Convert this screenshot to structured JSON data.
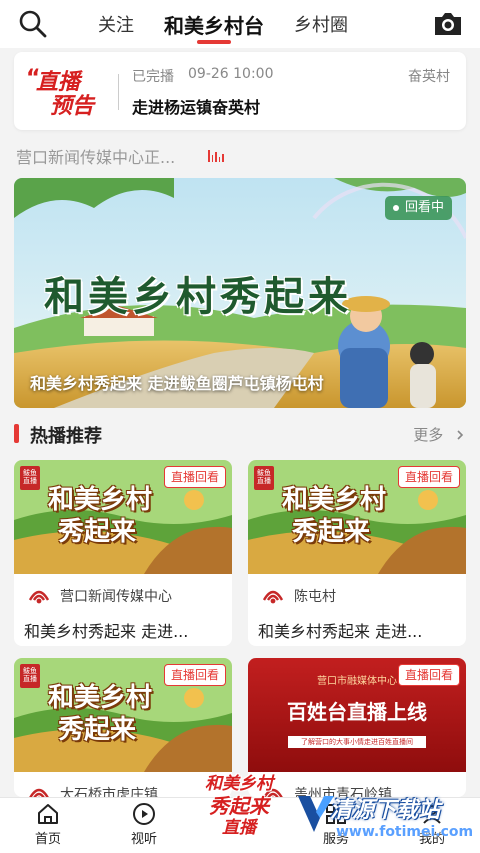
{
  "topbar": {
    "tabs": [
      "关注",
      "和美乡村台",
      "乡村圈"
    ],
    "active_tab": 1
  },
  "live_card": {
    "logo_line1": "直播",
    "logo_line2": "预告",
    "status": "已完播",
    "time": "09-26 10:00",
    "place": "奋英村",
    "title": "走进杨运镇奋英村"
  },
  "ticker": {
    "text": "营口新闻传媒中心正..."
  },
  "banner": {
    "badge": "回看中",
    "art_title": "和美乡村秀起来",
    "caption": "和美乡村秀起来 走进鲅鱼圈芦屯镇杨屯村"
  },
  "section": {
    "title": "热播推荐",
    "more": "更多"
  },
  "cards": [
    {
      "badge": "直播回看",
      "art_line1": "和美乡村",
      "art_line2": "秀起来",
      "logo": "鲅鱼直播",
      "source": "营口新闻传媒中心",
      "title": "和美乡村秀起来 走进..."
    },
    {
      "badge": "直播回看",
      "art_line1": "和美乡村",
      "art_line2": "秀起来",
      "logo": "鲅鱼直播",
      "source": "陈屯村",
      "title": "和美乡村秀起来 走进..."
    },
    {
      "badge": "直播回看",
      "art_line1": "和美乡村",
      "art_line2": "秀起来",
      "logo": "鲅鱼直播",
      "source": "大石桥市虎庄镇",
      "title": ""
    },
    {
      "badge": "直播回看",
      "red_small": "营口市融媒体中心",
      "red_title": "百姓台直播上线",
      "red_sub": "了解营口的大事小情走进百姓直播间",
      "source": "盖州市青石岭镇",
      "title": ""
    }
  ],
  "bottom_nav": {
    "items": [
      "首页",
      "视听",
      "服务",
      "我的"
    ],
    "center_line1": "和美乡村",
    "center_line2": "秀起来",
    "center_line3": "直播"
  },
  "watermark": {
    "main": "清源下载站",
    "url": "www.fotimei.com"
  },
  "colors": {
    "accent": "#e53935",
    "badge_green": "#3c965a",
    "background": "#f3f3f3"
  }
}
